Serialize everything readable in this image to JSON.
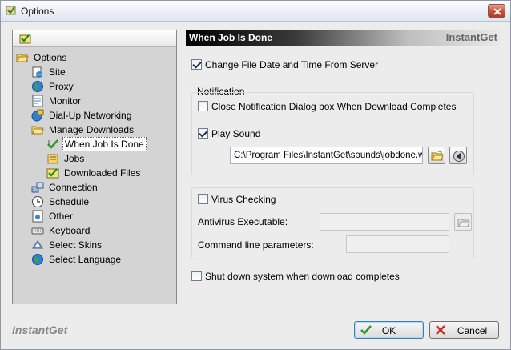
{
  "window": {
    "title": "Options"
  },
  "tree": {
    "items": [
      {
        "label": "Options",
        "icon": "folder-open-icon"
      },
      {
        "label": "Site",
        "icon": "site-icon"
      },
      {
        "label": "Proxy",
        "icon": "globe-icon"
      },
      {
        "label": "Monitor",
        "icon": "monitor-icon"
      },
      {
        "label": "Dial-Up Networking",
        "icon": "dialup-icon"
      },
      {
        "label": "Manage Downloads",
        "icon": "folder-open-icon"
      },
      {
        "label": "When Job Is Done",
        "icon": "arrow-check-icon"
      },
      {
        "label": "Jobs",
        "icon": "jobs-icon"
      },
      {
        "label": "Downloaded Files",
        "icon": "checked-folder-icon"
      },
      {
        "label": "Connection",
        "icon": "connection-icon"
      },
      {
        "label": "Schedule",
        "icon": "clock-icon"
      },
      {
        "label": "Other",
        "icon": "other-icon"
      },
      {
        "label": "Keyboard",
        "icon": "keyboard-icon"
      },
      {
        "label": "Select Skins",
        "icon": "skins-icon"
      },
      {
        "label": "Select Language",
        "icon": "globe-icon"
      }
    ]
  },
  "section": {
    "title": "When Job Is Done",
    "brand": "InstantGet"
  },
  "options": {
    "change_file_date": {
      "label": "Change File Date and Time From Server",
      "checked": true
    },
    "notification_group": "Notification",
    "close_notification": {
      "label": "Close Notification Dialog box When Download Completes",
      "checked": false
    },
    "play_sound": {
      "label": "Play Sound",
      "checked": true
    },
    "sound_path": "C:\\Program Files\\InstantGet\\sounds\\jobdone.wav",
    "virus_checking": {
      "label": "Virus Checking",
      "checked": false
    },
    "antivirus_label": "Antivirus Executable:",
    "antivirus_value": "",
    "cmdline_label": "Command line parameters:",
    "cmdline_value": "",
    "shutdown": {
      "label": "Shut down system when download completes",
      "checked": false
    }
  },
  "footer": {
    "brand": "InstantGet",
    "ok_label": "OK",
    "cancel_label": "Cancel"
  },
  "colors": {
    "accent": "#3c7fb1",
    "close": "#c8553d",
    "header_dark": "#000000"
  }
}
